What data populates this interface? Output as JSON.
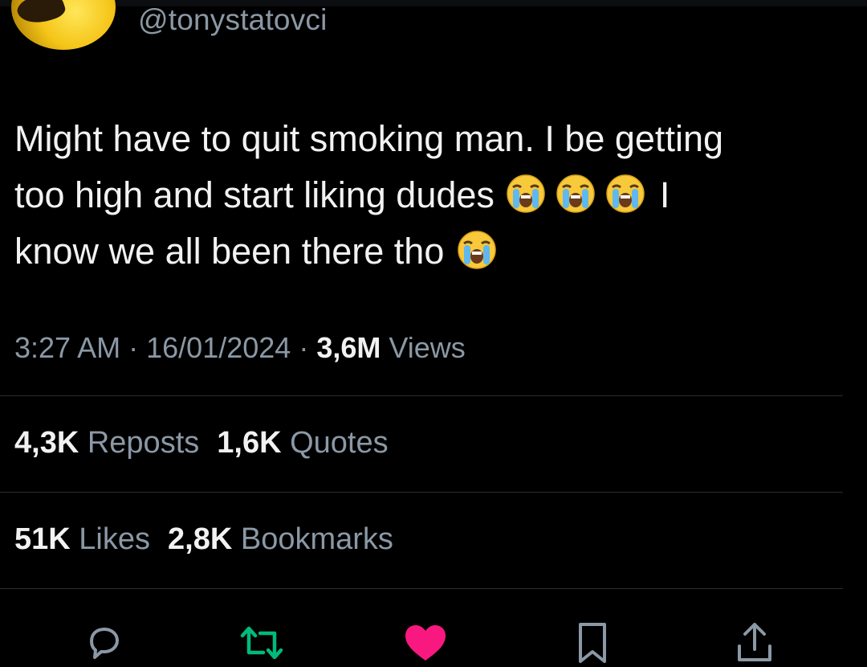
{
  "tweet": {
    "handle": "@tonystatovci",
    "text_line1": "Might have to quit smoking man. I be getting",
    "text_line2_before": "too high and start liking dudes",
    "text_line2_after": "I",
    "text_line3": "know we all been there tho",
    "emoji_name": "loudly-crying-face",
    "time": "3:27 AM",
    "separator": "·",
    "date": "16/01/2024",
    "views_count": "3,6M",
    "views_label": "Views"
  },
  "stats": {
    "reposts_count": "4,3K",
    "reposts_label": "Reposts",
    "quotes_count": "1,6K",
    "quotes_label": "Quotes",
    "likes_count": "51K",
    "likes_label": "Likes",
    "bookmarks_count": "2,8K",
    "bookmarks_label": "Bookmarks"
  },
  "actions": [
    {
      "icon": "reply-icon",
      "color": "#8b98a5"
    },
    {
      "icon": "repost-icon",
      "color": "#00ba7c"
    },
    {
      "icon": "like-icon",
      "color": "#f91880"
    },
    {
      "icon": "bookmark-icon",
      "color": "#8b98a5"
    },
    {
      "icon": "share-icon",
      "color": "#8b98a5"
    }
  ],
  "colors": {
    "background": "#000000",
    "primary_text": "#f2f2f2",
    "secondary_text": "#8b98a5",
    "divider": "#2a2f33",
    "repost_active": "#00ba7c",
    "like_active": "#f91880"
  }
}
